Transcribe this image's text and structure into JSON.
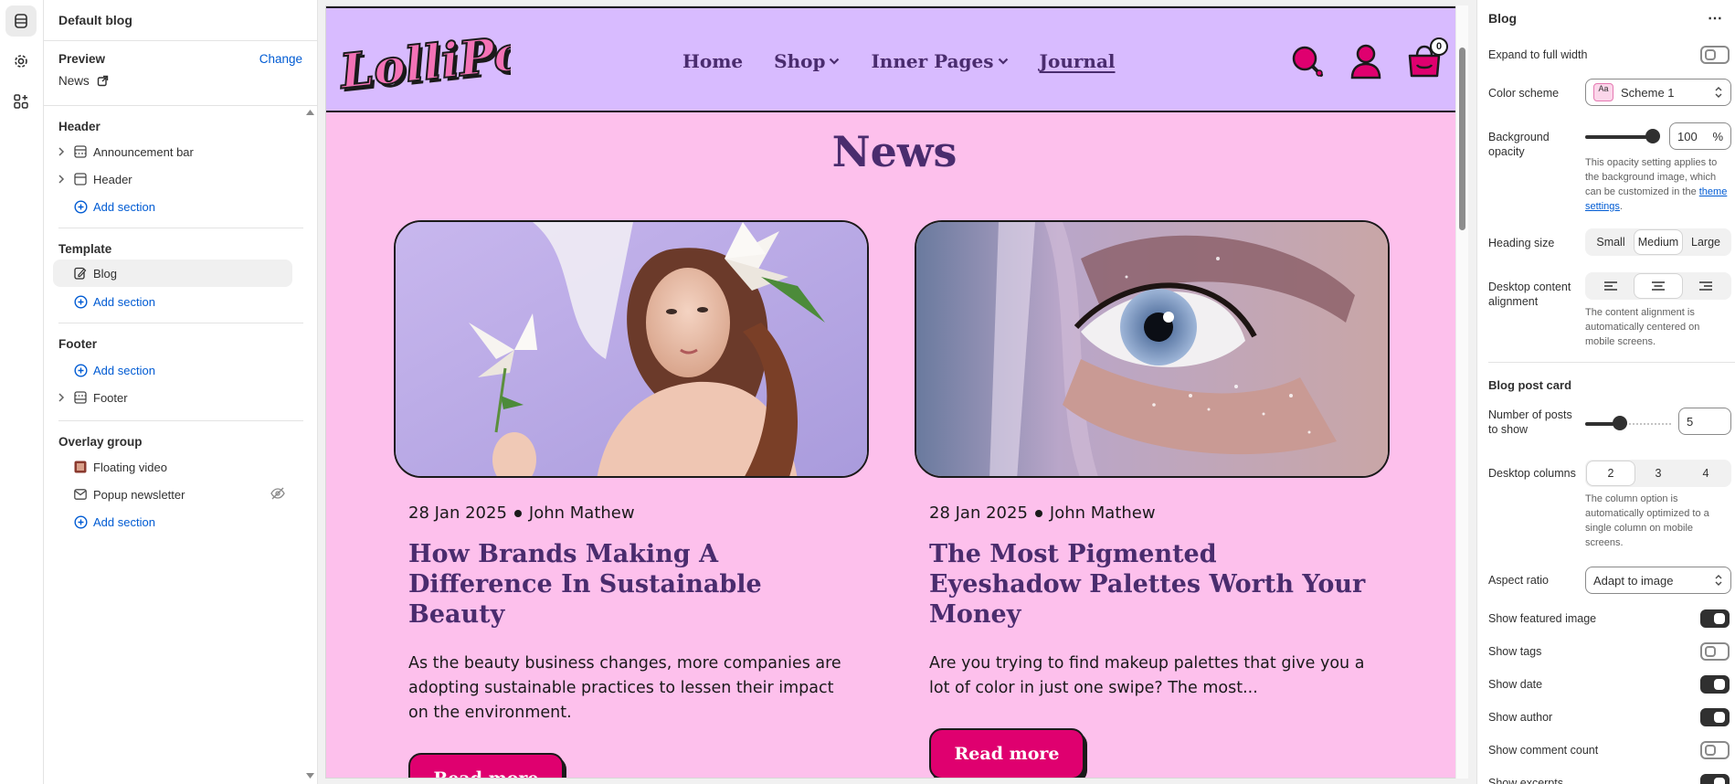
{
  "editor": {
    "blog_title": "Default blog",
    "preview_label": "Preview",
    "preview_change": "Change",
    "preview_page": "News",
    "groups": {
      "header": {
        "title": "Header",
        "items": [
          "Announcement bar",
          "Header"
        ],
        "add": "Add section"
      },
      "template": {
        "title": "Template",
        "items": [
          "Blog"
        ],
        "add": "Add section"
      },
      "footer": {
        "title": "Footer",
        "add": "Add section",
        "items": [
          "Footer"
        ]
      },
      "overlay": {
        "title": "Overlay group",
        "items": [
          "Floating video",
          "Popup newsletter"
        ],
        "add": "Add section"
      }
    }
  },
  "store": {
    "logo_text": "LolliPop",
    "nav": [
      "Home",
      "Shop",
      "Inner Pages",
      "Journal"
    ],
    "cart_count": "0",
    "page_title": "News",
    "colors": {
      "header_bg": "#d8bbff",
      "page_bg": "#fdc0ec",
      "accent": "#df006f",
      "heading": "#4a2c6e"
    },
    "posts": [
      {
        "date": "28 Jan 2025",
        "author": "John Mathew",
        "title": "How Brands Making A Difference In Sustainable Beauty",
        "excerpt": "As the beauty business changes, more companies are adopting sustainable practices to lessen their impact on the environment.",
        "button": "Read more"
      },
      {
        "date": "28 Jan 2025",
        "author": "John Mathew",
        "title": "The Most Pigmented Eyeshadow Palettes Worth Your Money",
        "excerpt": "Are you trying to find makeup palettes that give you a lot of color in just one swipe? The most...",
        "button": "Read more"
      }
    ]
  },
  "settings": {
    "title": "Blog",
    "more": "⋯",
    "expand_label": "Expand to full width",
    "color_scheme_label": "Color scheme",
    "color_scheme_value": "Scheme 1",
    "color_scheme_swatch": "Aa",
    "bg_opacity_label": "Background opacity",
    "bg_opacity_value": "100",
    "bg_opacity_unit": "%",
    "bg_opacity_help_1": "This opacity setting applies to the background image, which can be customized in the",
    "bg_opacity_help_link": "theme settings",
    "bg_opacity_help_end": ".",
    "heading_size_label": "Heading size",
    "heading_sizes": [
      "Small",
      "Medium",
      "Large"
    ],
    "heading_size_selected": "Medium",
    "alignment_label": "Desktop content alignment",
    "alignment_help": "The content alignment is automatically centered on mobile screens.",
    "card_section": "Blog post card",
    "posts_label": "Number of posts to show",
    "posts_value": "5",
    "posts_fraction": 0.25,
    "columns_label": "Desktop columns",
    "columns": [
      "2",
      "3",
      "4"
    ],
    "columns_selected": "2",
    "columns_help": "The column option is automatically optimized to a single column on mobile screens.",
    "aspect_label": "Aspect ratio",
    "aspect_value": "Adapt to image",
    "toggles": [
      {
        "label": "Show featured image",
        "on": true
      },
      {
        "label": "Show tags",
        "on": false
      },
      {
        "label": "Show date",
        "on": true
      },
      {
        "label": "Show author",
        "on": true
      },
      {
        "label": "Show comment count",
        "on": false
      },
      {
        "label": "Show excerpts",
        "on": true
      }
    ]
  }
}
